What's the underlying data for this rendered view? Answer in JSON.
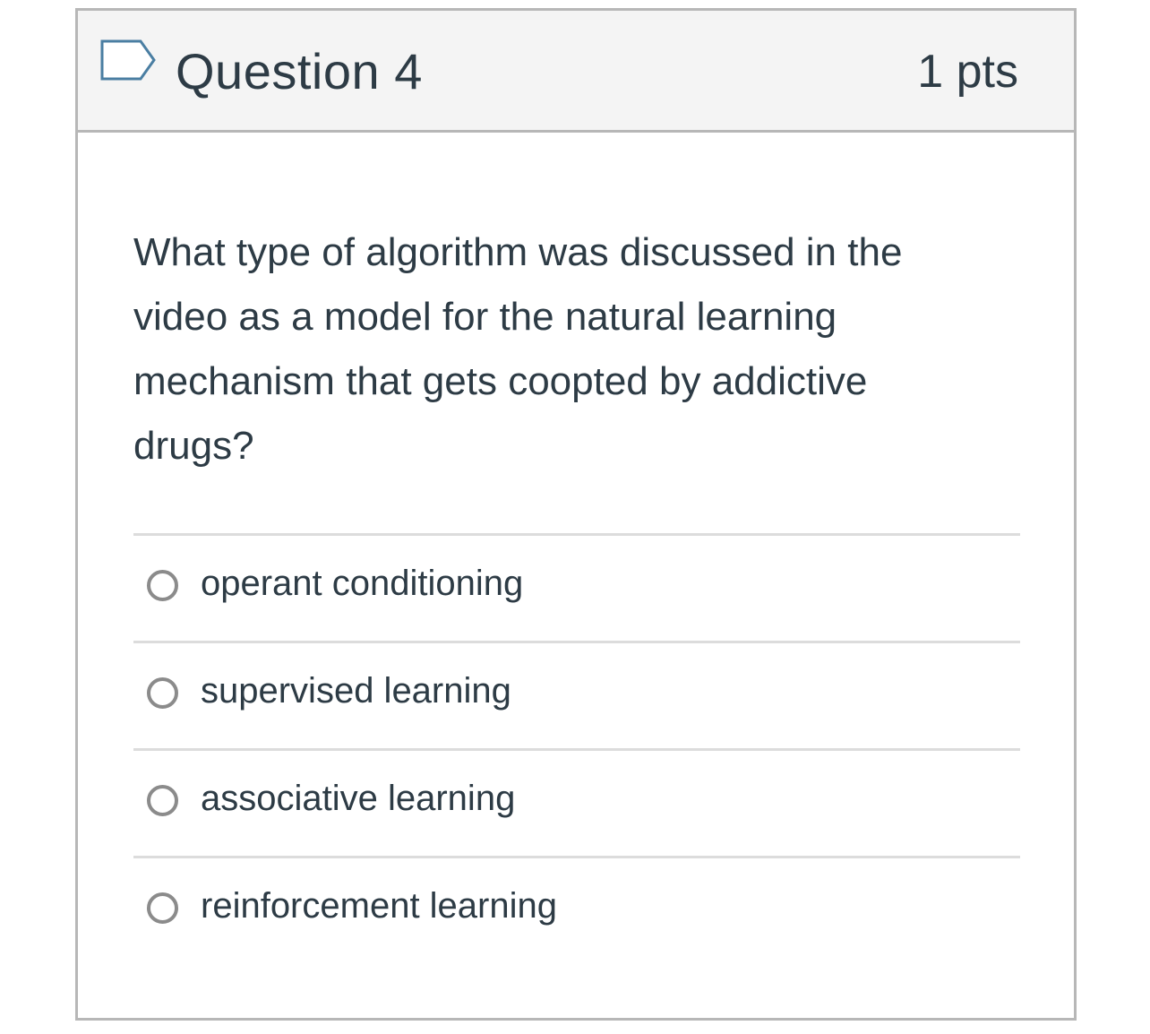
{
  "question": {
    "title": "Question 4",
    "points": "1 pts",
    "flag_icon": "flag-outline-icon",
    "text": "What type of algorithm was discussed in the video as a model for the natural learning mechanism that gets coopted by addictive drugs?"
  },
  "answers": [
    {
      "label": "operant conditioning",
      "selected": false
    },
    {
      "label": "supervised learning",
      "selected": false
    },
    {
      "label": "associative learning",
      "selected": false
    },
    {
      "label": "reinforcement learning",
      "selected": false
    }
  ],
  "colors": {
    "header_bg": "#f4f4f4",
    "border": "#b7b7b7",
    "text": "#2d3b45",
    "flag_stroke": "#4a7ea2",
    "radio_stroke": "#8b8b8b",
    "divider": "#dcdcdc"
  }
}
